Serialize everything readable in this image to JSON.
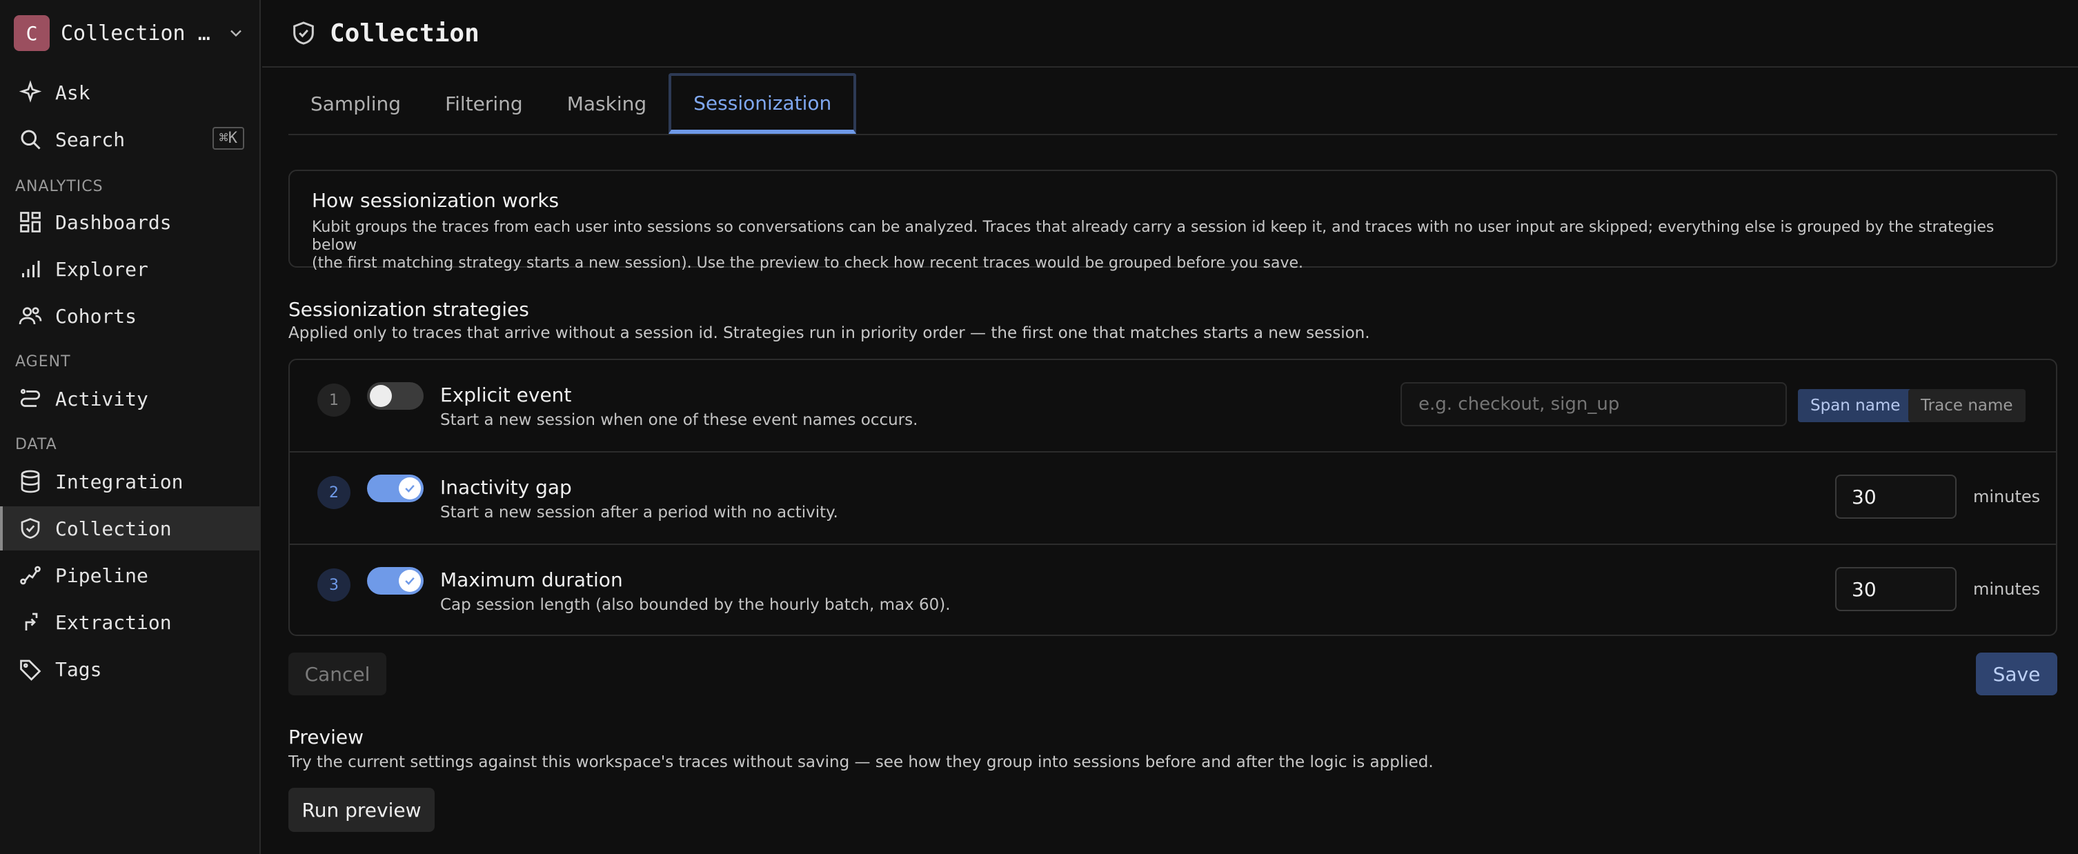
{
  "workspace": {
    "initial": "C",
    "name": "Collection test"
  },
  "sidebar": {
    "items": [
      {
        "label": "Ask",
        "icon": "sparkle-icon"
      },
      {
        "label": "Search",
        "icon": "search-icon",
        "shortcut": "⌘K"
      }
    ],
    "sections": [
      {
        "label": "ANALYTICS",
        "items": [
          {
            "label": "Dashboards",
            "icon": "dashboard-icon"
          },
          {
            "label": "Explorer",
            "icon": "bar-chart-icon"
          },
          {
            "label": "Cohorts",
            "icon": "users-icon"
          }
        ]
      },
      {
        "label": "AGENT",
        "items": [
          {
            "label": "Activity",
            "icon": "route-icon"
          }
        ]
      },
      {
        "label": "DATA",
        "items": [
          {
            "label": "Integration",
            "icon": "database-icon"
          },
          {
            "label": "Collection",
            "icon": "shield-check-icon",
            "active": true
          },
          {
            "label": "Pipeline",
            "icon": "pipeline-icon"
          },
          {
            "label": "Extraction",
            "icon": "extraction-icon"
          },
          {
            "label": "Tags",
            "icon": "tag-icon"
          }
        ]
      }
    ]
  },
  "header": {
    "title": "Collection",
    "icon": "shield-check-icon"
  },
  "tabs": [
    "Sampling",
    "Filtering",
    "Masking",
    "Sessionization"
  ],
  "active_tab": "Sessionization",
  "info": {
    "title": "How sessionization works",
    "body_line1": "Kubit groups the traces from each user into sessions so conversations can be analyzed. Traces that already carry a session id keep it, and traces with no user input are skipped; everything else is grouped by the strategies below",
    "body_line2": "(the first matching strategy starts a new session). Use the preview to check how recent traces would be grouped before you save."
  },
  "strategies": {
    "title": "Sessionization strategies",
    "subtitle": "Applied only to traces that arrive without a session id. Strategies run in priority order — the first one that matches starts a new session.",
    "rows": [
      {
        "num": "1",
        "enabled": false,
        "title": "Explicit event",
        "desc": "Start a new session when one of these event names occurs.",
        "placeholder": "e.g. checkout, sign_up",
        "seg_span": "Span name",
        "seg_trace": "Trace name"
      },
      {
        "num": "2",
        "enabled": true,
        "title": "Inactivity gap",
        "desc": "Start a new session after a period with no activity.",
        "value": "30",
        "unit": "minutes"
      },
      {
        "num": "3",
        "enabled": true,
        "title": "Maximum duration",
        "desc": "Cap session length (also bounded by the hourly batch, max 60).",
        "value": "30",
        "unit": "minutes"
      }
    ]
  },
  "actions": {
    "cancel": "Cancel",
    "save": "Save"
  },
  "preview": {
    "title": "Preview",
    "subtitle": "Try the current settings against this workspace's traces without saving — see how they group into sessions before and after the logic is applied.",
    "button": "Run preview"
  },
  "colors": {
    "accent": "#6f9ae8",
    "avatar": "#9b4f5f",
    "background": "#0f0f0f"
  }
}
